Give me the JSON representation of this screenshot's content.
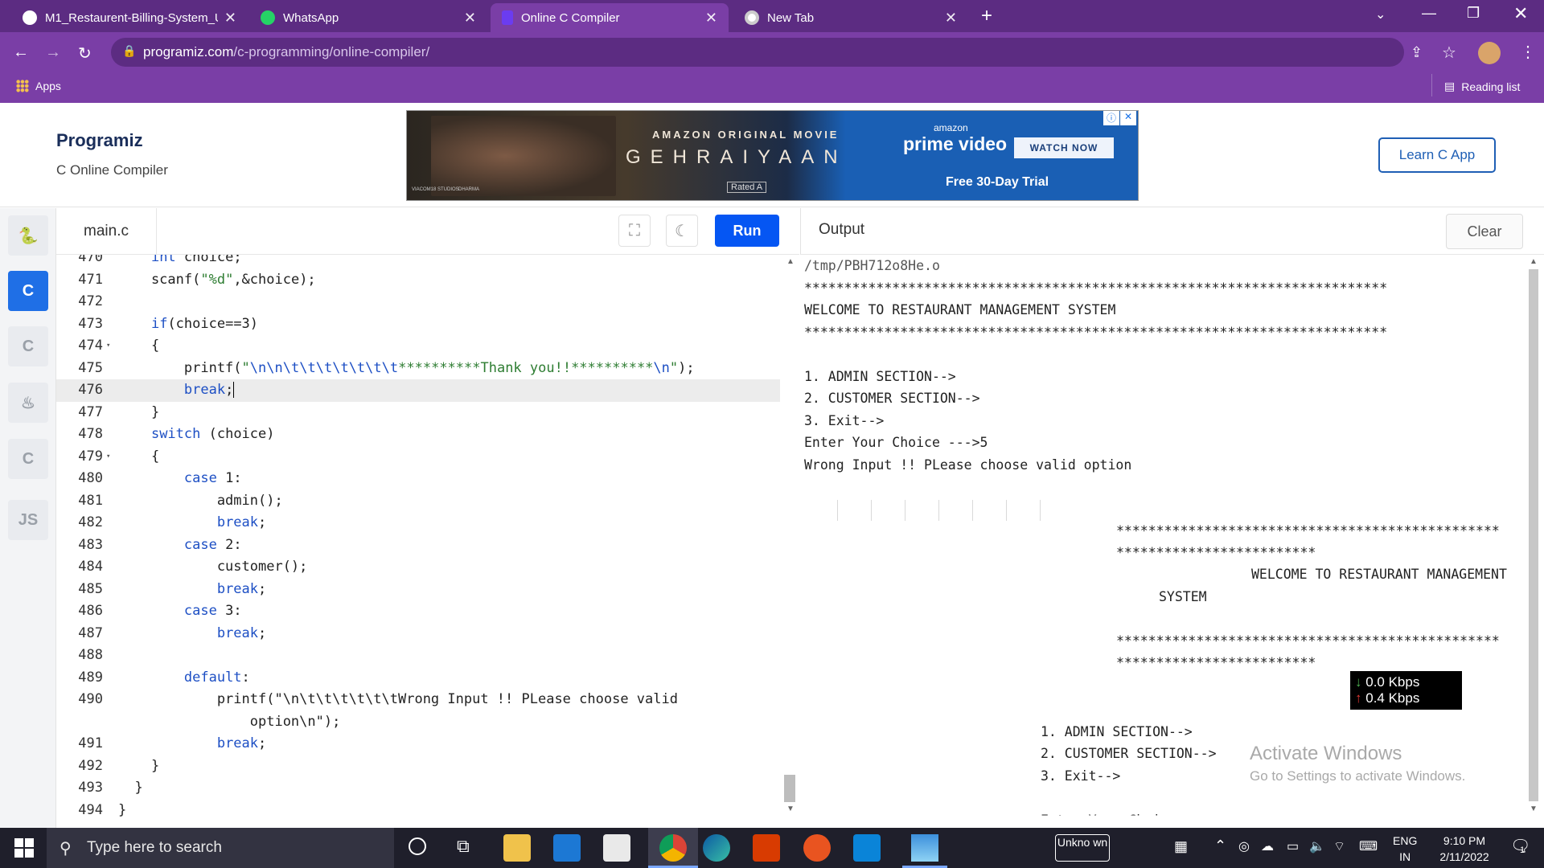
{
  "browser": {
    "tabs": [
      {
        "title": "M1_Restaurent-Billing-System_U",
        "icon": "github-icon"
      },
      {
        "title": "WhatsApp",
        "icon": "whatsapp-icon"
      },
      {
        "title": "Online C Compiler",
        "icon": "programiz-icon"
      },
      {
        "title": "New Tab",
        "icon": "chrome-icon"
      }
    ],
    "url_domain": "programiz.com",
    "url_path": "/c-programming/online-compiler/",
    "bookmarks_apps": "Apps",
    "reading_list": "Reading list"
  },
  "header": {
    "logo": "Programiz",
    "subtitle": "C Online Compiler",
    "learn_button": "Learn C App",
    "ad": {
      "line1": "AMAZON ORIGINAL MOVIE",
      "title": "GEHRAIYAAN",
      "rated": "Rated A",
      "brand_top": "amazon",
      "brand": "prime video",
      "cta": "WATCH NOW",
      "trial": "Free 30-Day Trial",
      "studio1": "VIACOM18 STUDIOS",
      "studio2": "DHARMA"
    }
  },
  "rail": {
    "js_label": "JS"
  },
  "editor": {
    "filename": "main.c",
    "run_label": "Run",
    "lines": [
      {
        "n": "470",
        "code": "    int choice;"
      },
      {
        "n": "471",
        "code": "    scanf(\"%d\",&choice);"
      },
      {
        "n": "472",
        "code": ""
      },
      {
        "n": "473",
        "code": "    if(choice==3)"
      },
      {
        "n": "474",
        "code": "    {",
        "fold": true
      },
      {
        "n": "475",
        "code": "        printf(\"\\n\\n\\t\\t\\t\\t\\t\\t\\t**********Thank you!!**********\\n\");"
      },
      {
        "n": "476",
        "code": "        break;",
        "highlight": true
      },
      {
        "n": "477",
        "code": "    }"
      },
      {
        "n": "478",
        "code": "    switch (choice)"
      },
      {
        "n": "479",
        "code": "    {",
        "fold": true
      },
      {
        "n": "480",
        "code": "        case 1:"
      },
      {
        "n": "481",
        "code": "            admin();"
      },
      {
        "n": "482",
        "code": "            break;"
      },
      {
        "n": "483",
        "code": "        case 2:"
      },
      {
        "n": "484",
        "code": "            customer();"
      },
      {
        "n": "485",
        "code": "            break;"
      },
      {
        "n": "486",
        "code": "        case 3:"
      },
      {
        "n": "487",
        "code": "            break;"
      },
      {
        "n": "488",
        "code": ""
      },
      {
        "n": "489",
        "code": "        default:"
      },
      {
        "n": "490",
        "code": "            printf(\"\\n\\t\\t\\t\\t\\t\\tWrong Input !! PLease choose valid"
      },
      {
        "n": "",
        "code": "                option\\n\");"
      },
      {
        "n": "491",
        "code": "            break;"
      },
      {
        "n": "492",
        "code": "    }"
      },
      {
        "n": "493",
        "code": "  }"
      },
      {
        "n": "494",
        "code": "}"
      }
    ]
  },
  "output": {
    "title": "Output",
    "clear_label": "Clear",
    "lines": [
      "/tmp/PBH712o8He.o",
      "*************************************************************************",
      "WELCOME TO RESTAURANT MANAGEMENT SYSTEM",
      "*************************************************************************",
      "",
      "1. ADMIN SECTION-->",
      "2. CUSTOMER SECTION-->",
      "3. Exit-->",
      "Enter Your Choice --->5",
      "Wrong Input !! PLease choose valid option"
    ],
    "tab_block": {
      "stars1": "************************************************",
      "stars1b": "*************************",
      "welcome": "WELCOME TO RESTAURANT MANAGEMENT",
      "system": "SYSTEM",
      "stars2": "************************************************",
      "stars2b": "*************************",
      "menu1": "1. ADMIN SECTION-->",
      "menu2": "2. CUSTOMER SECTION-->",
      "menu3": "3. Exit-->",
      "partial": "Enter Your Choice --->"
    },
    "net_down": "0.0 Kbps",
    "net_up": "0.4 Kbps",
    "activate_title": "Activate Windows",
    "activate_sub": "Go to Settings to activate Windows."
  },
  "taskbar": {
    "search_placeholder": "Type here to search",
    "unknown_label": "Unkno wn",
    "lang1": "ENG",
    "lang2": "IN",
    "time": "9:10 PM",
    "date": "2/11/2022",
    "notif_count": "1"
  }
}
